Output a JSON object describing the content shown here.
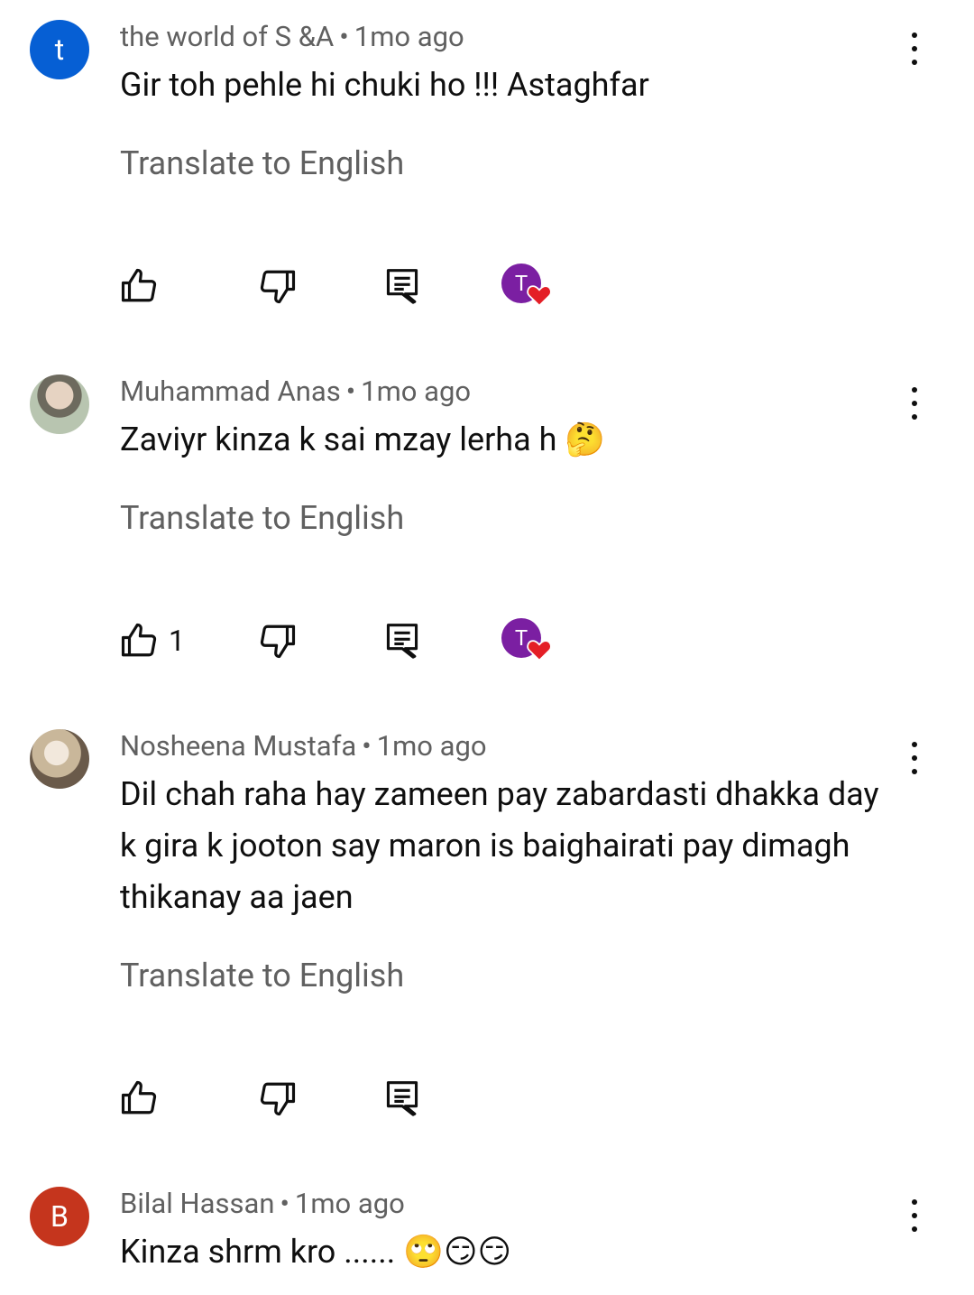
{
  "comments": [
    {
      "avatar_letter": "t",
      "avatar_color": "#065fd4",
      "author": "the world of S &A",
      "time": "1mo ago",
      "text": "Gir toh pehle hi chuki ho !!! Astaghfar",
      "translate": "Translate to English",
      "likes": "",
      "creator_heart_letter": "T"
    },
    {
      "author": "Muhammad Anas",
      "time": "1mo ago",
      "text": "Zaviyr kinza k sai mzay lerha h 🤔",
      "translate": "Translate to English",
      "likes": "1",
      "creator_heart_letter": "T"
    },
    {
      "author": "Nosheena Mustafa",
      "time": "1mo ago",
      "text": "Dil chah raha hay zameen pay zabardasti dhakka day k gira k jooton say maron is baighairati pay dimagh thikanay aa jaen",
      "translate": "Translate to English",
      "likes": ""
    },
    {
      "avatar_letter": "B",
      "avatar_color": "#c5351d",
      "author": "Bilal Hassan",
      "time": "1mo ago",
      "text": "Kinza shrm kro ...... 🙄😏😏"
    }
  ],
  "separator": "•",
  "icons": {
    "like": "thumb-up-outline-icon",
    "dislike": "thumb-down-outline-icon",
    "reply": "comment-reply-icon",
    "menu": "more-vert-icon",
    "heart": "creator-heart-icon"
  },
  "heart_color": "#e41e26",
  "creator_color": "#7b1fa2"
}
